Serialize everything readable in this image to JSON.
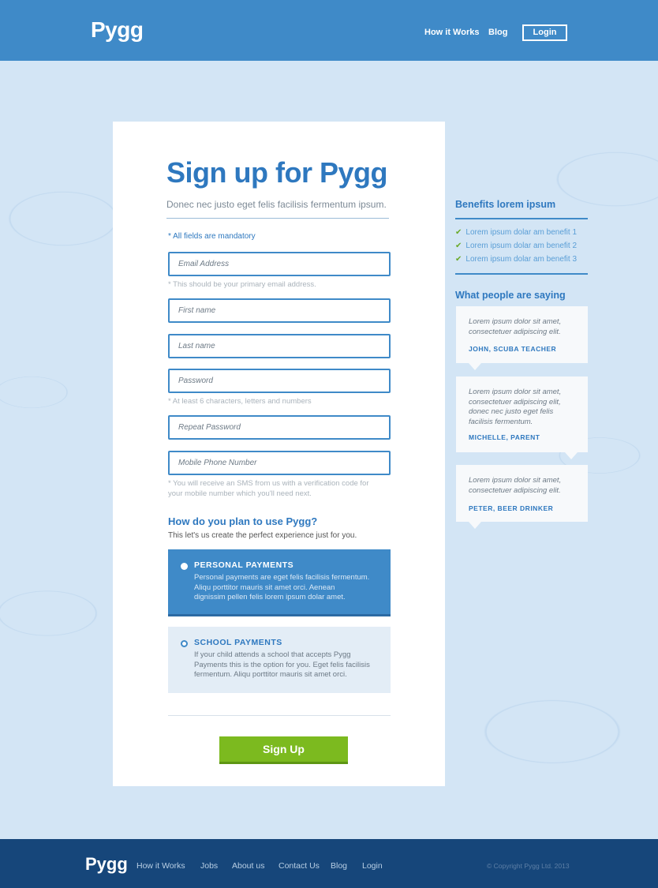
{
  "header": {
    "logo": "Pygg",
    "nav": [
      "How it Works",
      "Blog"
    ],
    "login_label": "Login"
  },
  "form": {
    "title": "Sign up for Pygg",
    "subtitle": "Donec nec justo eget felis facilisis fermentum ipsum.",
    "mandatory_note": "* All fields are mandatory",
    "fields": {
      "email_placeholder": "Email Address",
      "email_hint": "* This should be your primary email address.",
      "first_name_placeholder": "First name",
      "last_name_placeholder": "Last name",
      "password_placeholder": "Password",
      "password_hint": "* At least 6 characters, letters and numbers",
      "repeat_password_placeholder": "Repeat Password",
      "mobile_placeholder": "Mobile Phone Number",
      "mobile_hint_line1": "* You will receive an SMS from us with a verification code for",
      "mobile_hint_line2": "your mobile number which you'll need next."
    },
    "plan_question": "How do you plan to use Pygg?",
    "plan_subtext": "This let's us create the perfect experience just for you.",
    "options": [
      {
        "title": "PERSONAL PAYMENTS",
        "selected": true,
        "desc_lines": [
          "Personal payments are eget felis facilisis fermentum.",
          "Aliqu porttitor mauris sit amet orci. Aenean",
          "dignissim pellen felis lorem ipsum dolar amet."
        ]
      },
      {
        "title": "SCHOOL PAYMENTS",
        "selected": false,
        "desc_lines": [
          "If your child attends a school that accepts Pygg",
          "Payments this is the option for you. Eget felis facilisis",
          "fermentum. Aliqu porttitor mauris sit amet orci."
        ]
      }
    ],
    "submit_label": "Sign Up"
  },
  "sidebar": {
    "benefits_heading": "Benefits lorem ipsum",
    "benefits": [
      "Lorem ipsum dolar am benefit 1",
      "Lorem ipsum dolar am benefit 2",
      "Lorem ipsum dolar am benefit 3"
    ],
    "testimonials_heading": "What people are saying",
    "testimonials": [
      {
        "quote_lines": [
          "Lorem ipsum dolor sit amet,",
          "consectetuer adipiscing elit."
        ],
        "author": "JOHN, SCUBA TEACHER"
      },
      {
        "quote_lines": [
          "Lorem ipsum dolor sit amet,",
          "consectetuer adipiscing elit,",
          "donec nec justo eget felis",
          "facilisis fermentum."
        ],
        "author": "MICHELLE, PARENT"
      },
      {
        "quote_lines": [
          "Lorem ipsum dolor sit amet,",
          "consectetuer adipiscing elit."
        ],
        "author": "PETER, BEER DRINKER"
      }
    ]
  },
  "footer": {
    "logo": "Pygg",
    "links": [
      "How it Works",
      "Jobs",
      "About us",
      "Contact Us",
      "Blog",
      "Login"
    ],
    "copyright": "© Copyright Pygg Ltd. 2013"
  },
  "colors": {
    "header_blue": "#3f8ac8",
    "footer_navy": "#16467a",
    "accent_blue": "#2e78bf",
    "signup_green": "#7cba1f",
    "page_bg": "#d4e6f6"
  },
  "icons": {
    "benefit_bullet": "check-icon",
    "radio_selected": "radio-filled-icon",
    "radio_unselected": "radio-empty-icon"
  }
}
